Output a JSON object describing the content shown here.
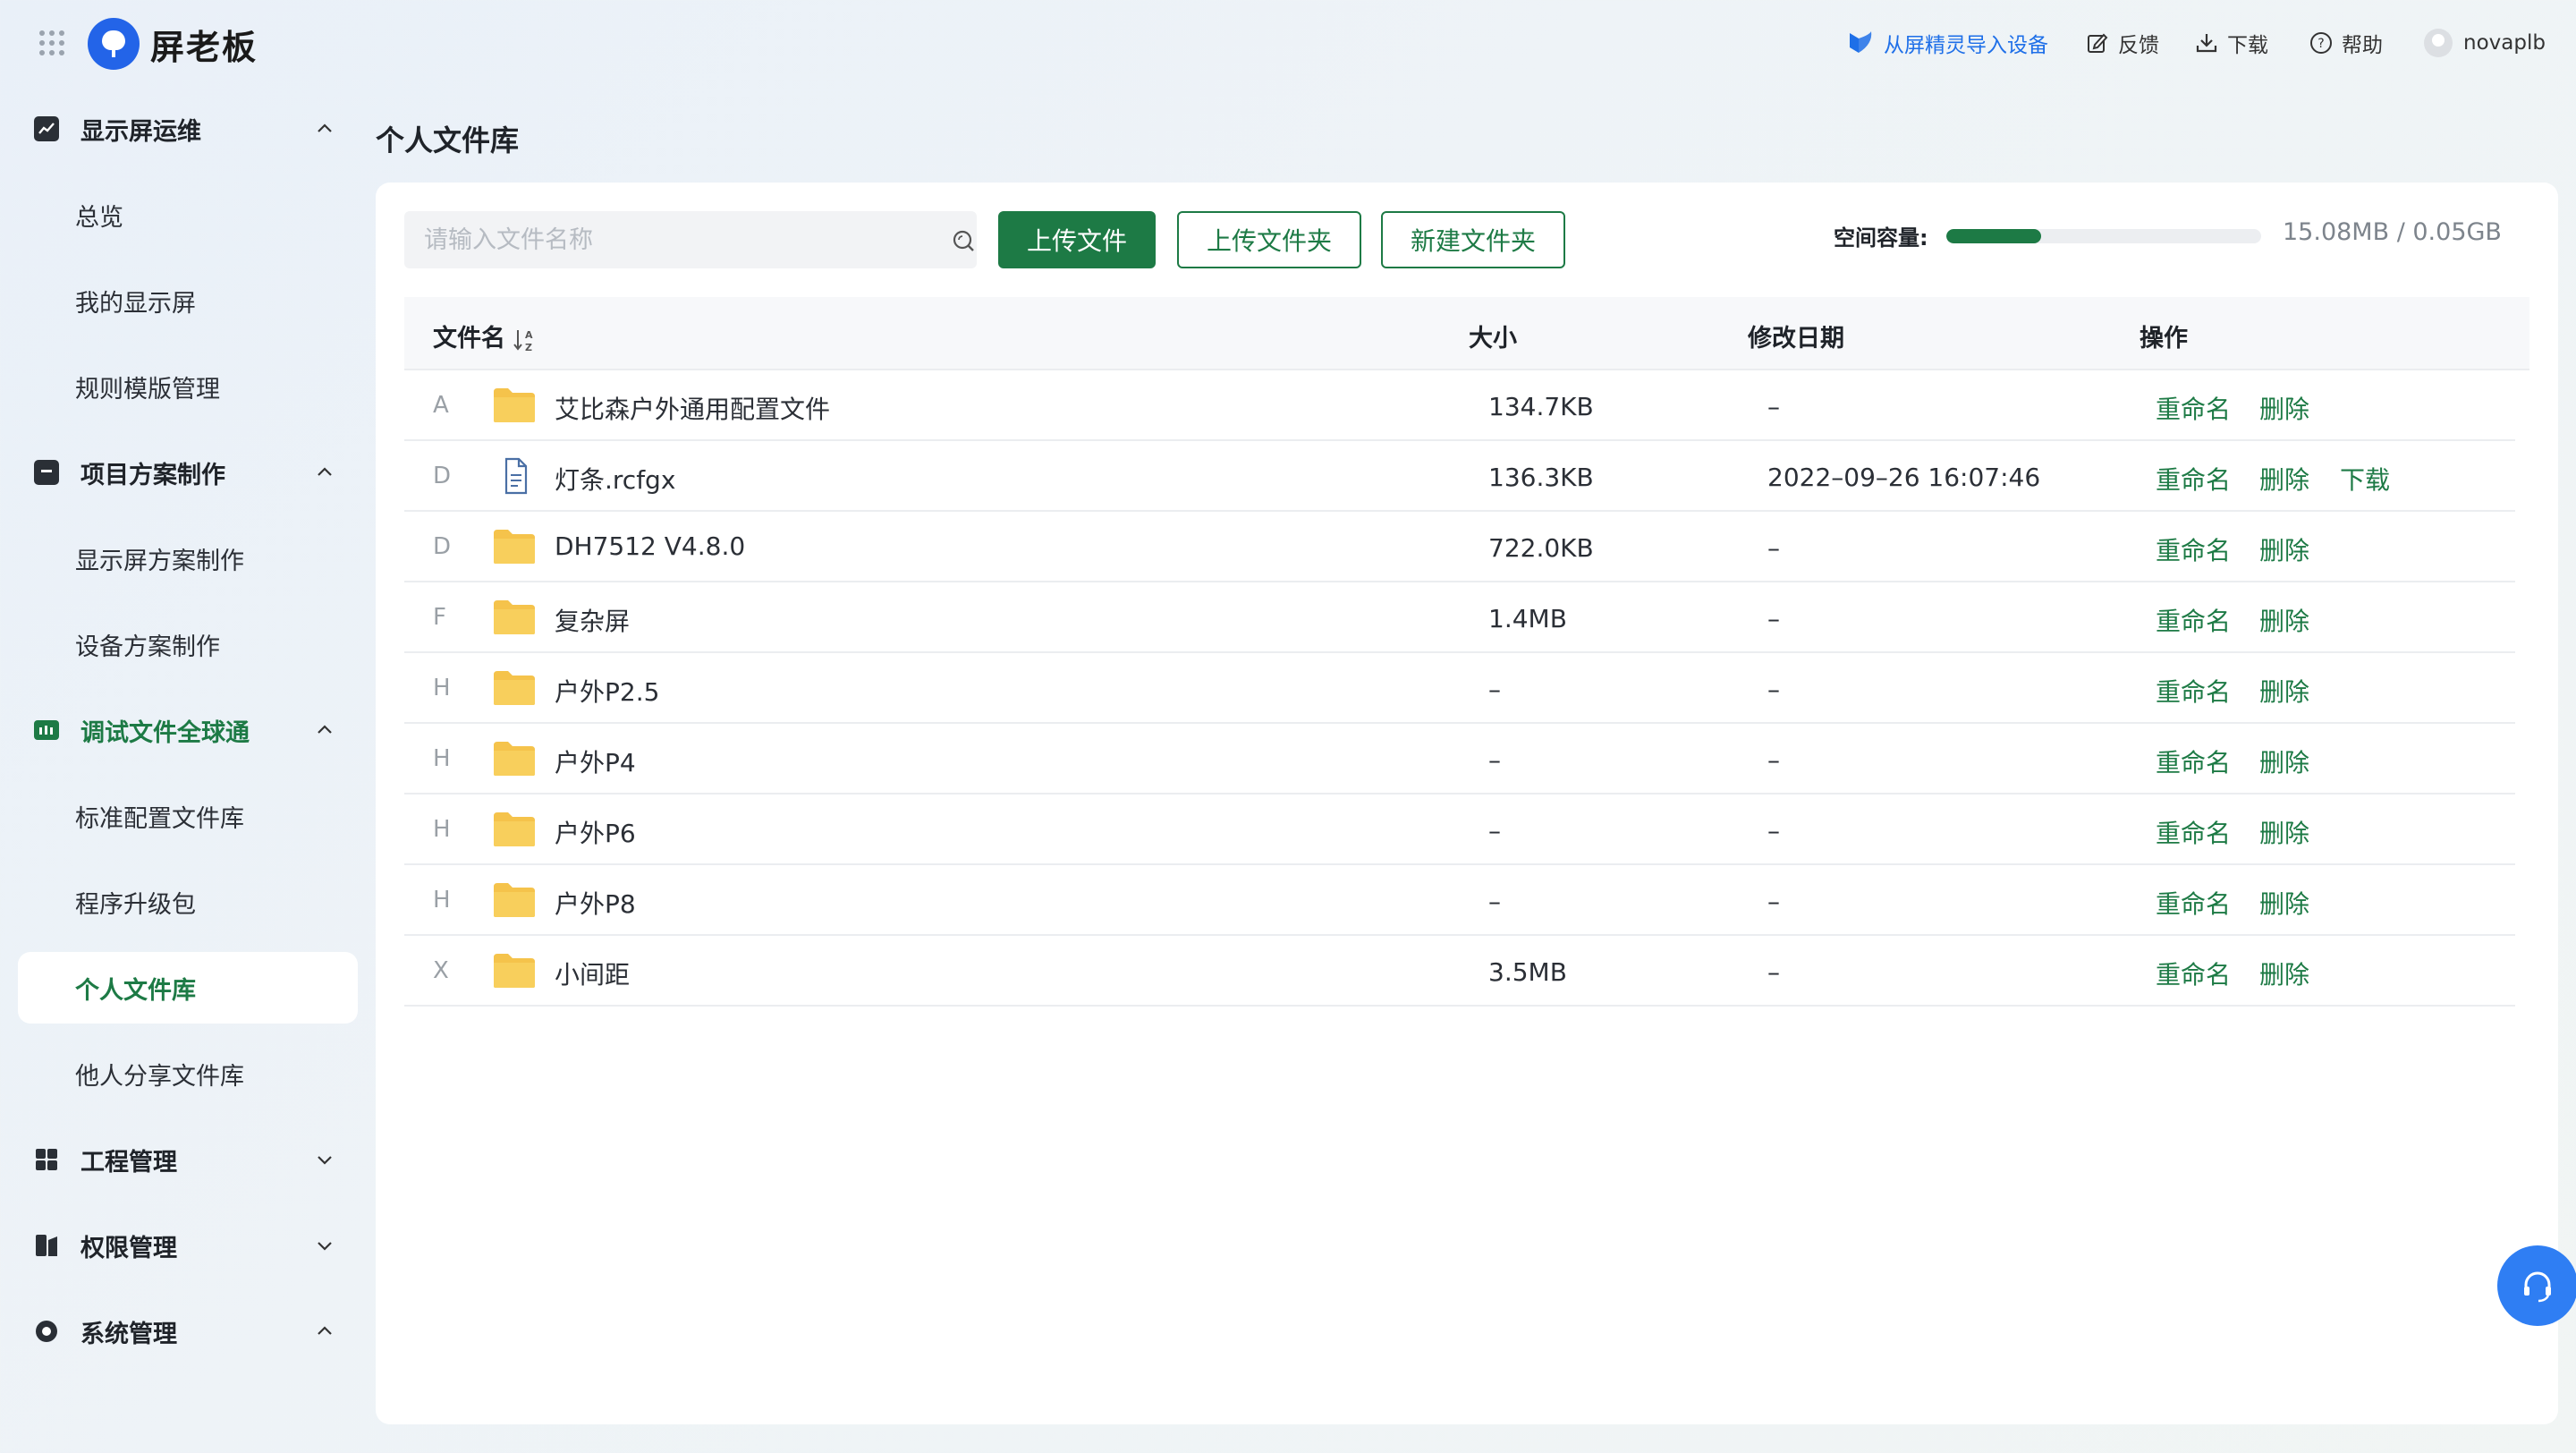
{
  "app": {
    "brand": "屏老板"
  },
  "topbar": {
    "import_label": "从屏精灵导入设备",
    "feedback_label": "反馈",
    "download_label": "下载",
    "help_label": "帮助",
    "username": "novaplb"
  },
  "sidebar": {
    "groups": [
      {
        "label": "显示屏运维",
        "icon": "chart-line-icon",
        "expanded": true,
        "items": [
          {
            "label": "总览"
          },
          {
            "label": "我的显示屏"
          },
          {
            "label": "规则模版管理"
          }
        ]
      },
      {
        "label": "项目方案制作",
        "icon": "briefcase-icon",
        "expanded": true,
        "items": [
          {
            "label": "显示屏方案制作"
          },
          {
            "label": "设备方案制作"
          }
        ]
      },
      {
        "label": "调试文件全球通",
        "icon": "battery-icon",
        "expanded": true,
        "active": true,
        "items": [
          {
            "label": "标准配置文件库"
          },
          {
            "label": "程序升级包"
          },
          {
            "label": "个人文件库",
            "selected": true
          },
          {
            "label": "他人分享文件库"
          }
        ]
      },
      {
        "label": "工程管理",
        "icon": "grid-blocks-icon",
        "expanded": false,
        "items": []
      },
      {
        "label": "权限管理",
        "icon": "permission-icon",
        "expanded": false,
        "items": []
      },
      {
        "label": "系统管理",
        "icon": "settings-circle-icon",
        "expanded": true,
        "items": []
      }
    ]
  },
  "page": {
    "title": "个人文件库"
  },
  "toolbar": {
    "search_placeholder": "请输入文件名称",
    "upload_file": "上传文件",
    "upload_folder": "上传文件夹",
    "new_folder": "新建文件夹",
    "capacity_label": "空间容量:",
    "capacity_text": "15.08MB / 0.05GB",
    "capacity_used_fraction": 0.3
  },
  "table": {
    "columns": [
      "文件名",
      "大小",
      "修改日期",
      "操作"
    ],
    "rows": [
      {
        "letter": "A",
        "type": "folder",
        "name": "艾比森户外通用配置文件",
        "size": "134.7KB",
        "date": "–",
        "actions": [
          "重命名",
          "删除"
        ]
      },
      {
        "letter": "D",
        "type": "file",
        "name": "灯条.rcfgx",
        "size": "136.3KB",
        "date": "2022–09–26 16:07:46",
        "actions": [
          "重命名",
          "删除",
          "下载"
        ]
      },
      {
        "letter": "D",
        "type": "folder",
        "name": "DH7512 V4.8.0",
        "size": "722.0KB",
        "date": "–",
        "actions": [
          "重命名",
          "删除"
        ]
      },
      {
        "letter": "F",
        "type": "folder",
        "name": "复杂屏",
        "size": "1.4MB",
        "date": "–",
        "actions": [
          "重命名",
          "删除"
        ]
      },
      {
        "letter": "H",
        "type": "folder",
        "name": "户外P2.5",
        "size": "–",
        "date": "–",
        "actions": [
          "重命名",
          "删除"
        ]
      },
      {
        "letter": "H",
        "type": "folder",
        "name": "户外P4",
        "size": "–",
        "date": "–",
        "actions": [
          "重命名",
          "删除"
        ]
      },
      {
        "letter": "H",
        "type": "folder",
        "name": "户外P6",
        "size": "–",
        "date": "–",
        "actions": [
          "重命名",
          "删除"
        ]
      },
      {
        "letter": "H",
        "type": "folder",
        "name": "户外P8",
        "size": "–",
        "date": "–",
        "actions": [
          "重命名",
          "删除"
        ]
      },
      {
        "letter": "X",
        "type": "folder",
        "name": "小间距",
        "size": "3.5MB",
        "date": "–",
        "actions": [
          "重命名",
          "删除"
        ]
      }
    ]
  },
  "colors": {
    "accent": "#1d7a45",
    "link_blue": "#1e6fe8",
    "folder": "#f5c34b"
  }
}
